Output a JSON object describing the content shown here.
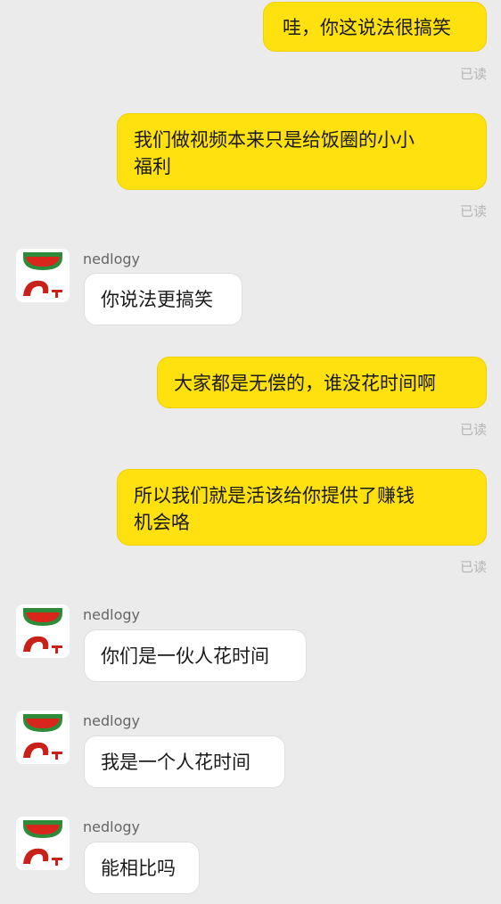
{
  "read_status": "已读",
  "sender_name": "nedlogy",
  "messages": [
    {
      "dir": "out",
      "text": "哇，你这说法很搞笑",
      "status": "已读"
    },
    {
      "dir": "out",
      "lines": [
        "我们做视频本来只是给饭圈的小小",
        "福利"
      ],
      "status": "已读"
    },
    {
      "dir": "in",
      "sender": "nedlogy",
      "text": "你说法更搞笑"
    },
    {
      "dir": "out",
      "text": "大家都是无偿的，谁没花时间啊",
      "status": "已读"
    },
    {
      "dir": "out",
      "lines": [
        "所以我们就是活该给你提供了赚钱",
        "机会咯"
      ],
      "status": "已读"
    },
    {
      "dir": "in",
      "sender": "nedlogy",
      "text": "你们是一伙人花时间"
    },
    {
      "dir": "in",
      "sender": "nedlogy",
      "text": "我是一个人花时间"
    },
    {
      "dir": "in",
      "sender": "nedlogy",
      "text": "能相比吗"
    }
  ],
  "colors": {
    "outgoing_bubble": "#ffe10f",
    "incoming_bubble": "#ffffff",
    "background": "#ebebeb",
    "status_text": "#b5b5b5",
    "avatar_green": "#2e8b3a",
    "avatar_red": "#d9261c"
  }
}
